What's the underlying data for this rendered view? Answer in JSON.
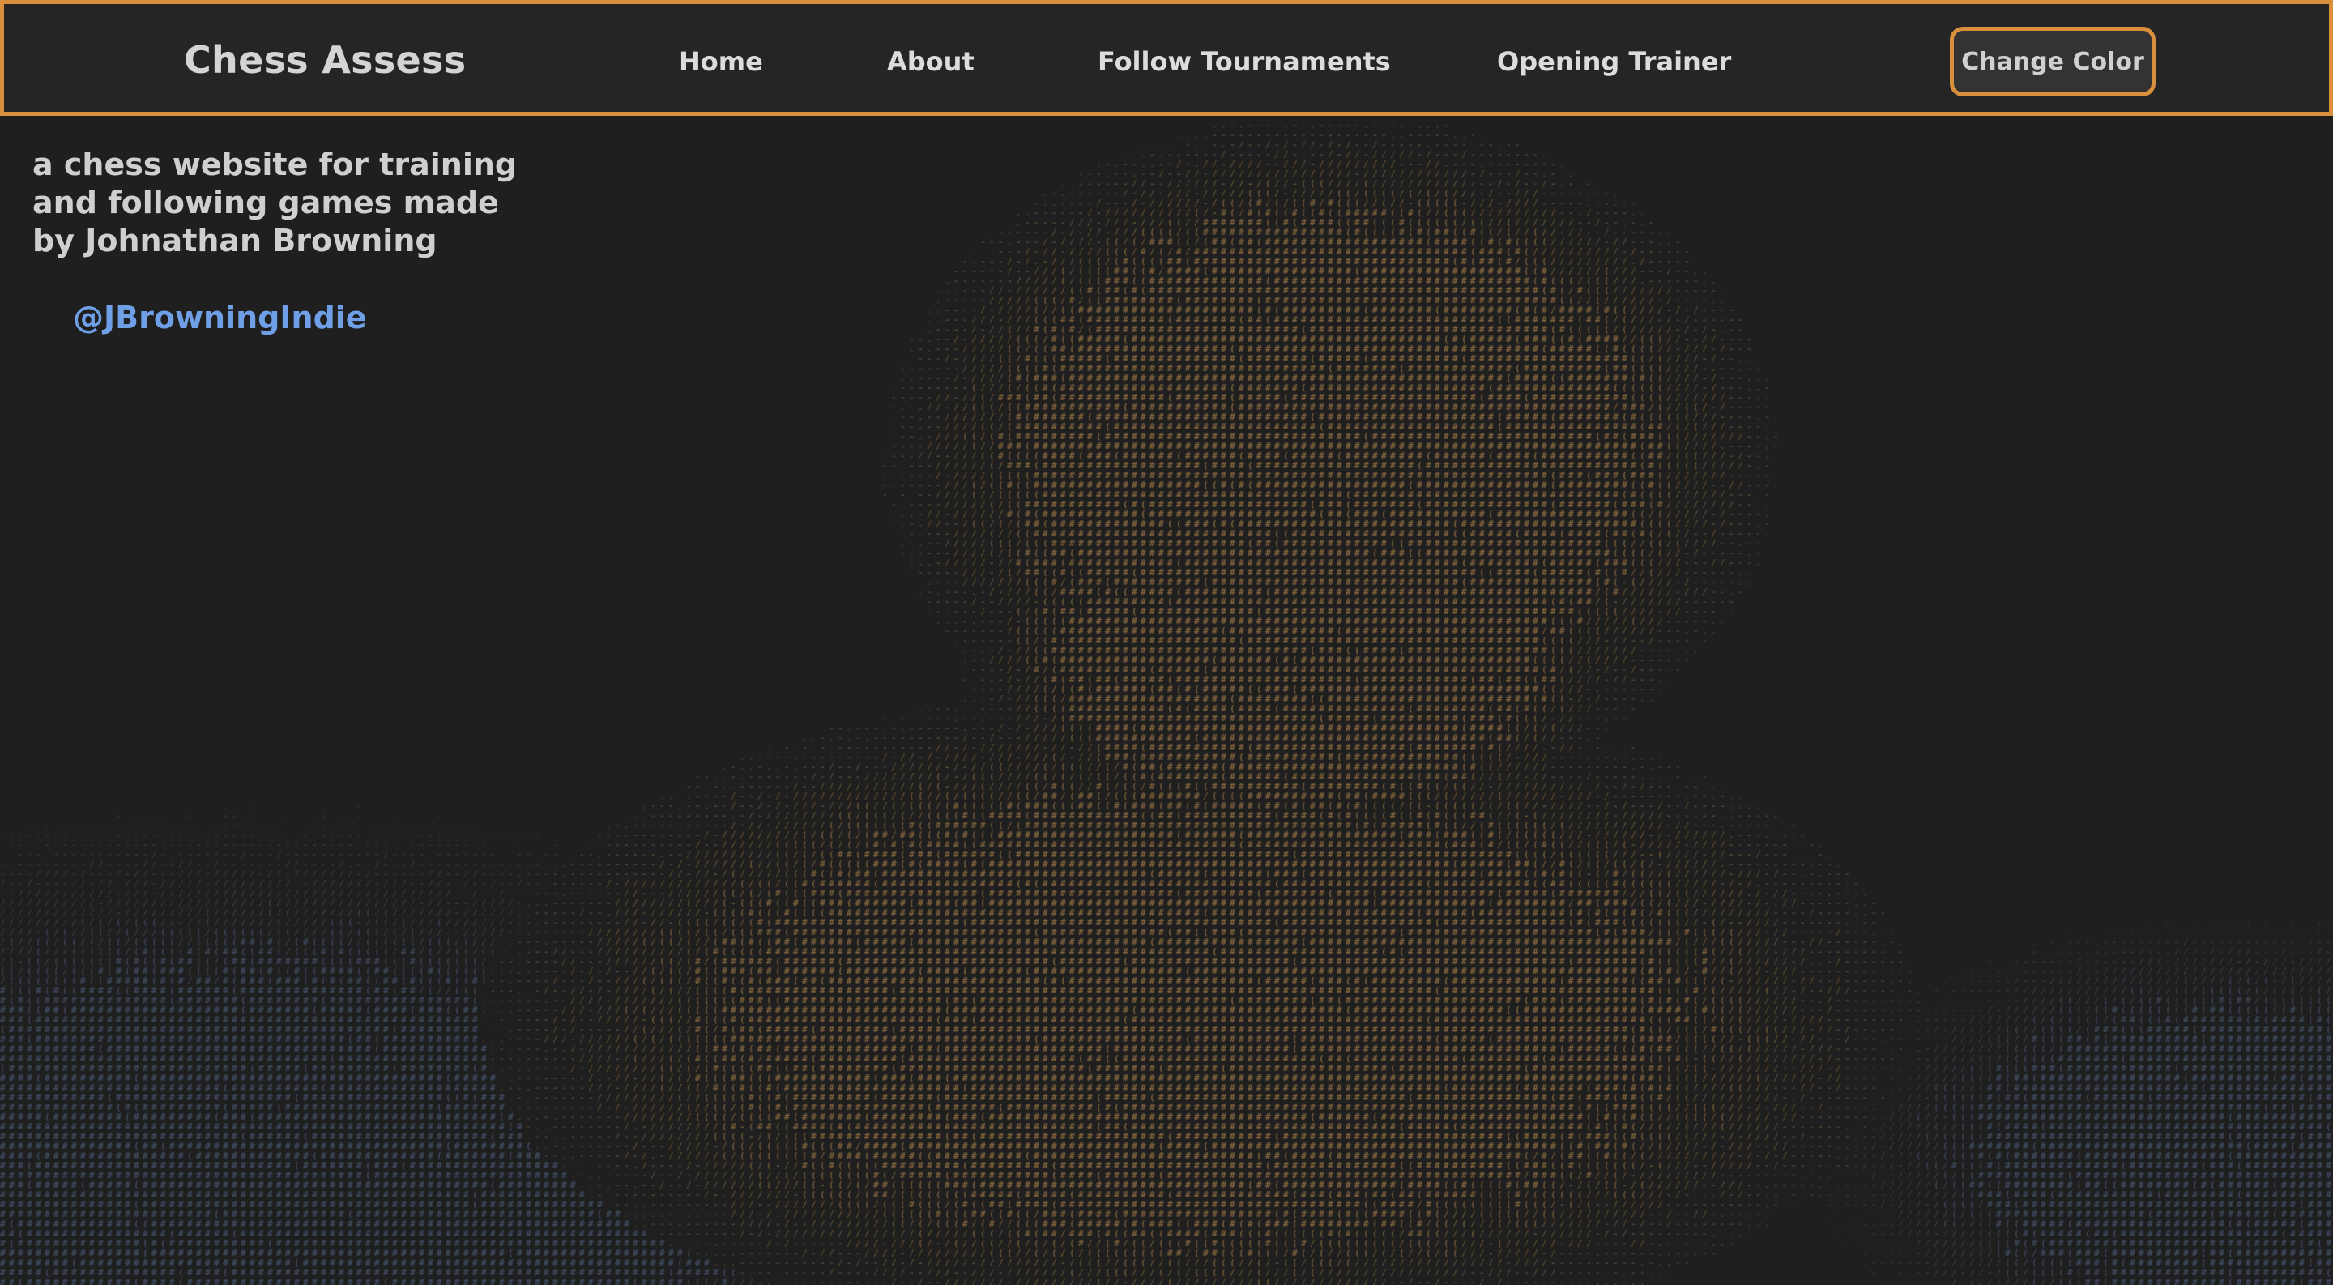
{
  "navbar": {
    "brand": "Chess Assess",
    "links": [
      {
        "label": "Home"
      },
      {
        "label": "About"
      },
      {
        "label": "Follow Tournaments"
      },
      {
        "label": "Opening Trainer"
      }
    ],
    "change_color_label": "Change Color"
  },
  "intro": {
    "text": "a chess website for training and following games made by Johnathan Browning",
    "handle": "@JBrowningIndie"
  },
  "colors": {
    "background": "#1f1f1f",
    "accent": "#d98f3c",
    "link": "#6f9fe6",
    "art_warm": "#a8804a",
    "art_cool": "#5a6f94"
  },
  "background_art": {
    "style": "ascii-art",
    "glyphs": [
      ".",
      "-",
      "/",
      "(",
      "#"
    ]
  }
}
